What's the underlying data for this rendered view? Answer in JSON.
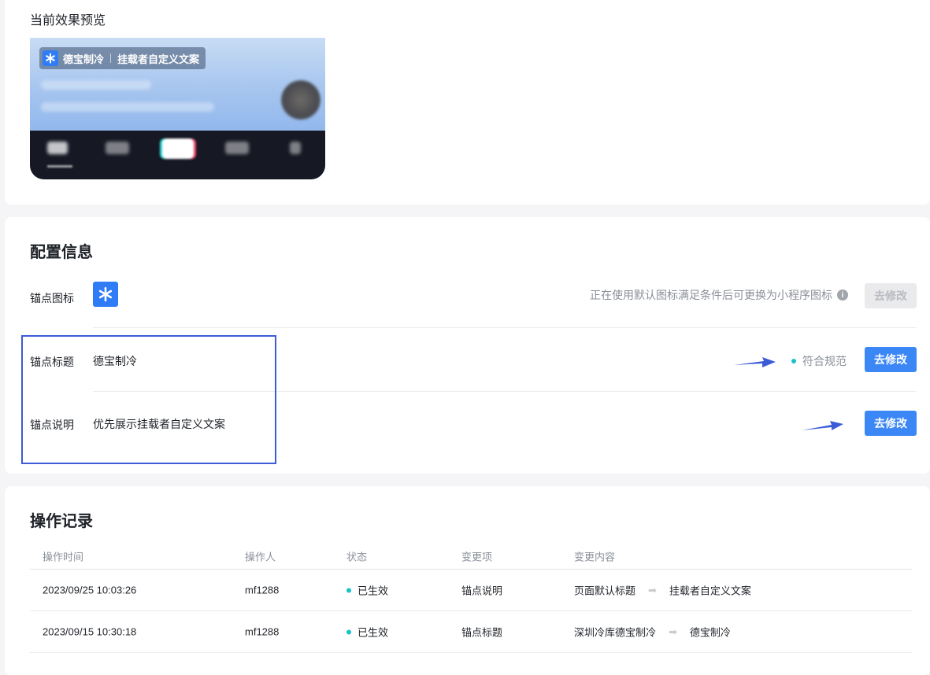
{
  "preview": {
    "title": "当前效果预览",
    "anchor_name": "德宝制冷",
    "anchor_desc": "挂载者自定义文案"
  },
  "config": {
    "title": "配置信息",
    "rows": [
      {
        "label": "锚点图标",
        "hint": "正在使用默认图标满足条件后可更换为小程序图标",
        "button": "去修改",
        "button_state": "disabled"
      },
      {
        "label": "锚点标题",
        "value": "德宝制冷",
        "status": "符合规范",
        "button": "去修改",
        "button_state": "primary"
      },
      {
        "label": "锚点说明",
        "value": "优先展示挂载者自定义文案",
        "button": "去修改",
        "button_state": "primary"
      }
    ]
  },
  "log": {
    "title": "操作记录",
    "headers": [
      "操作时间",
      "操作人",
      "状态",
      "变更项",
      "变更内容"
    ],
    "rows": [
      {
        "time": "2023/09/25 10:03:26",
        "operator": "mf1288",
        "status": "已生效",
        "item": "锚点说明",
        "from": "页面默认标题",
        "to": "挂载者自定义文案"
      },
      {
        "time": "2023/09/15 10:30:18",
        "operator": "mf1288",
        "status": "已生效",
        "item": "锚点标题",
        "from": "深圳冷库德宝制冷",
        "to": "德宝制冷"
      }
    ]
  },
  "colors": {
    "primary": "#3b87f6",
    "status_dot": "#17c2c8",
    "annotation": "#3b5cd6"
  }
}
